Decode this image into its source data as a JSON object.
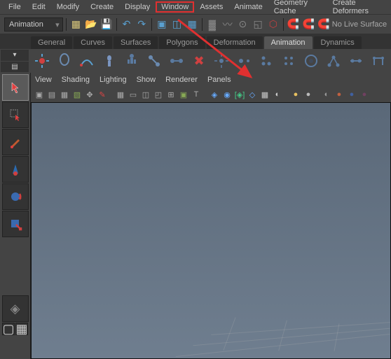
{
  "menubar": {
    "items": [
      "File",
      "Edit",
      "Modify",
      "Create",
      "Display",
      "Window",
      "Assets",
      "Animate",
      "Geometry Cache",
      "Create Deformers"
    ]
  },
  "toolbar": {
    "mode_dropdown": "Animation",
    "live_surface_label": "No Live Surface"
  },
  "shelf": {
    "tabs": [
      "General",
      "Curves",
      "Surfaces",
      "Polygons",
      "Deformation",
      "Animation",
      "Dynamics"
    ],
    "active_tab": "Animation"
  },
  "panel_menu": {
    "items": [
      "View",
      "Shading",
      "Lighting",
      "Show",
      "Renderer",
      "Panels"
    ]
  },
  "icons": {
    "new": "new-scene",
    "open": "open-scene",
    "save": "save-scene",
    "undo": "undo",
    "redo": "redo",
    "select": "select-tool",
    "lasso": "lasso-tool",
    "paint": "paint-select",
    "move": "move-tool",
    "rotate": "rotate-tool",
    "scale": "scale-tool",
    "manip": "show-manip",
    "layout": "layout",
    "grid": "snap-grid",
    "curve": "snap-curve",
    "point": "snap-point",
    "magnet": "snap",
    "render": "render",
    "ipr": "ipr-render",
    "render_settings": "render-settings"
  }
}
